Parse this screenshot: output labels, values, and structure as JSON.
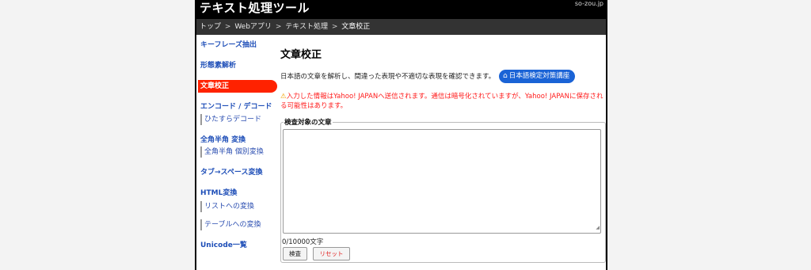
{
  "header": {
    "title": "テキスト処理ツール",
    "domain": "so-zou.jp"
  },
  "breadcrumb": {
    "items": [
      "トップ",
      "Webアプリ",
      "テキスト処理",
      "文章校正"
    ],
    "separator": ">"
  },
  "sidebar": {
    "items": [
      {
        "label": "キーフレーズ抽出"
      },
      {
        "label": "形態素解析"
      },
      {
        "label": "文章校正",
        "active": true
      },
      {
        "label": "エンコード / デコード"
      },
      {
        "label": "ひたすらデコード"
      },
      {
        "label": "全角半角 変換"
      },
      {
        "label": "全角半角 個別変換"
      },
      {
        "label": "タブ→スペース変換"
      },
      {
        "label": "HTML変換"
      },
      {
        "label": "リストへの変換"
      },
      {
        "label": "テーブルへの変換"
      },
      {
        "label": "Unicode一覧"
      }
    ]
  },
  "main": {
    "title": "文章校正",
    "description": "日本語の文章を解析し、間違った表現や不適切な表現を確認できます。",
    "tag_button": "日本語検定対策講座",
    "warning_icon": "warning-icon",
    "warning": "入力した情報はYahoo! JAPANへ送信されます。通信は暗号化されていますが、Yahoo! JAPANに保存される可能性はあります。",
    "fieldset_legend": "検査対象の文章",
    "textarea_value": "",
    "counter": "0/10000文字",
    "check_button": "検査",
    "reset_button": "リセット"
  },
  "colors": {
    "header_bg": "#000000",
    "breadcrumb_bg": "#333333",
    "nav_link": "#1f4fb8",
    "active_nav": "#ff2200",
    "tag_button": "#1a63d6",
    "warning_text": "#ff1a1a"
  }
}
